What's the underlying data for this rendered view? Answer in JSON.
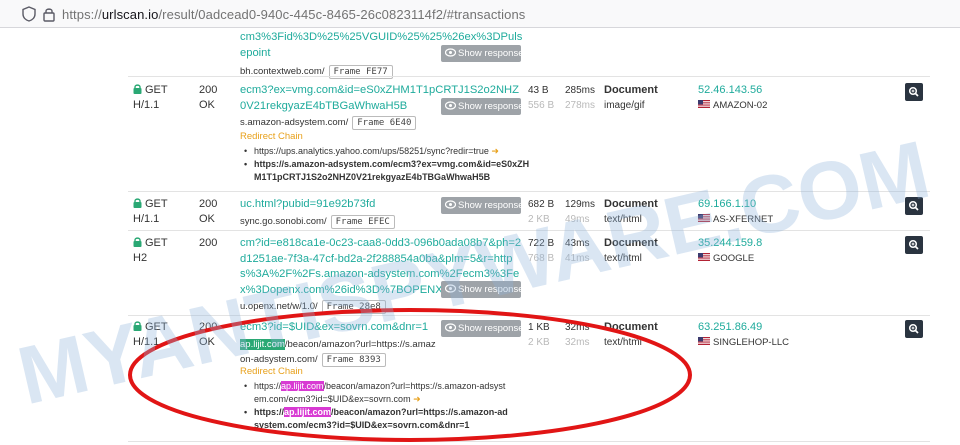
{
  "browser": {
    "url_prefix": "https://",
    "url_host": "urlscan.io",
    "url_path": "/result/0adcead0-940c-445c-8465-26c0823114f2/#transactions"
  },
  "common": {
    "show_response": "Show response",
    "redirect_chain": "Redirect Chain"
  },
  "rows": [
    {
      "url": "cm3%3Fid%3D%25%25VGUID%25%25%26ex%3DPulsepoint",
      "host": "bh.contextweb.com/",
      "frame": "Frame FE77"
    },
    {
      "method": "GET",
      "proto": "H/1.1",
      "status": "200",
      "status_text": "OK",
      "url": "ecm3?ex=vmg.com&id=eS0xZHM1T1pCRTJ1S2o2NHZ0V21rekgyazE4bTBGaWhwaH5B",
      "host": "s.amazon-adsystem.com/",
      "frame": "Frame 6E40",
      "size": "43 B",
      "size_t": "556 B",
      "time": "285ms",
      "time_t": "278ms",
      "type": "Document",
      "mime": "image/gif",
      "ip": "52.46.143.56",
      "asn": "AMAZON-02",
      "redirects": [
        "https://ups.analytics.yahoo.com/ups/58251/sync?redir=true",
        "https://s.amazon-adsystem.com/ecm3?ex=vmg.com&id=eS0xZHM1T1pCRTJ1S2o2NHZ0V21rekgyazE4bTBGaWhwaH5B"
      ]
    },
    {
      "method": "GET",
      "proto": "H/1.1",
      "status": "200",
      "status_text": "OK",
      "url": "uc.html?pubid=91e92b73fd",
      "host": "sync.go.sonobi.com/",
      "frame": "Frame EFEC",
      "size": "682 B",
      "size_t": "2 KB",
      "time": "129ms",
      "time_t": "49ms",
      "type": "Document",
      "mime": "text/html",
      "ip": "69.166.1.10",
      "asn": "AS-XFERNET"
    },
    {
      "method": "GET",
      "proto": "H2",
      "status": "200",
      "status_text": "",
      "url": "cm?id=e818ca1e-0c23-caa8-0dd3-096b0ada08b7&ph=2d1251ae-7f3a-47cf-bd2a-2f288854a0ba&plm=5&r=https%3A%2F%2Fs.amazon-adsystem.com%2Fecm3%3Fex%3Dopenx.com%26id%3D%7BOPENX_ID%7D",
      "host": "u.openx.net/w/1.0/",
      "frame": "Frame 28e8",
      "size": "722 B",
      "size_t": "768 B",
      "time": "43ms",
      "time_t": "41ms",
      "type": "Document",
      "mime": "text/html",
      "ip": "35.244.159.8",
      "asn": "GOOGLE"
    },
    {
      "method": "GET",
      "proto": "H/1.1",
      "status": "200",
      "status_text": "OK",
      "url": "ecm3?id=$UID&ex=sovrn.com&dnr=1",
      "host_hl": "ap.lijit.com",
      "host_rest": "/beacon/amazon?url=https://s.amazon-adsystem.com/",
      "frame": "Frame 8393",
      "size": "1 KB",
      "size_t": "2 KB",
      "time": "32ms",
      "time_t": "32ms",
      "type": "Document",
      "mime": "text/html",
      "ip": "63.251.86.49",
      "asn": "SINGLEHOP-LLC",
      "redirects": [
        {
          "pre": "https://",
          "hl": "ap.lijit.com",
          "post": "/beacon/amazon?url=https://s.amazon-adsystem.com/ecm3?id=$UID&ex=sovrn.com"
        },
        {
          "pre": "https://",
          "hl": "ap.lijit.com",
          "post": "/beacon/amazon?url=https://s.amazon-adsystem.com/ecm3?id=$UID&ex=sovrn.com&dnr=1"
        }
      ]
    }
  ],
  "watermark": "MYANTISPYWARE.COM",
  "colors": {
    "link": "#1fab9c",
    "redirect": "#e8a11c",
    "highlight": "#d83ad3",
    "oval": "#e11515",
    "watermark": "#8fb3dc"
  }
}
